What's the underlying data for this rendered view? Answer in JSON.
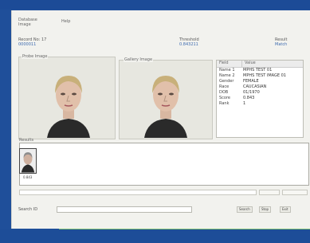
{
  "menu": {
    "item1": "Database",
    "item2": "Image",
    "item3": "Help"
  },
  "fields": {
    "record_label": "Record No: 17",
    "record_value": "0000011",
    "center_label": "Threshold",
    "center_value": "0.843211",
    "right_label": "Result",
    "right_value": "Match"
  },
  "panels": {
    "left_label": "Probe Image",
    "middle_label": "Gallery Image"
  },
  "info": {
    "headers": [
      "Field",
      "Value"
    ],
    "rows": [
      {
        "k": "Name 1",
        "v": "MPHS TEST 01"
      },
      {
        "k": "Name 2",
        "v": "MPHS TEST IMAGE 01"
      },
      {
        "k": "Gender",
        "v": "FEMALE"
      },
      {
        "k": "Race",
        "v": "CAUCASIAN"
      },
      {
        "k": "DOB",
        "v": "01/1970"
      },
      {
        "k": "Score",
        "v": "0.843"
      },
      {
        "k": "Rank",
        "v": "1"
      }
    ]
  },
  "gallery": {
    "label": "Results",
    "thumb_label": "0.843"
  },
  "status": {
    "label": "Search ID",
    "btn1": "Search",
    "btn2": "Stop",
    "btn3": "Exit"
  },
  "colors": {
    "frame": "#1f4f9a",
    "accent_green": "#7fc174",
    "value_blue": "#3d6bb0"
  }
}
